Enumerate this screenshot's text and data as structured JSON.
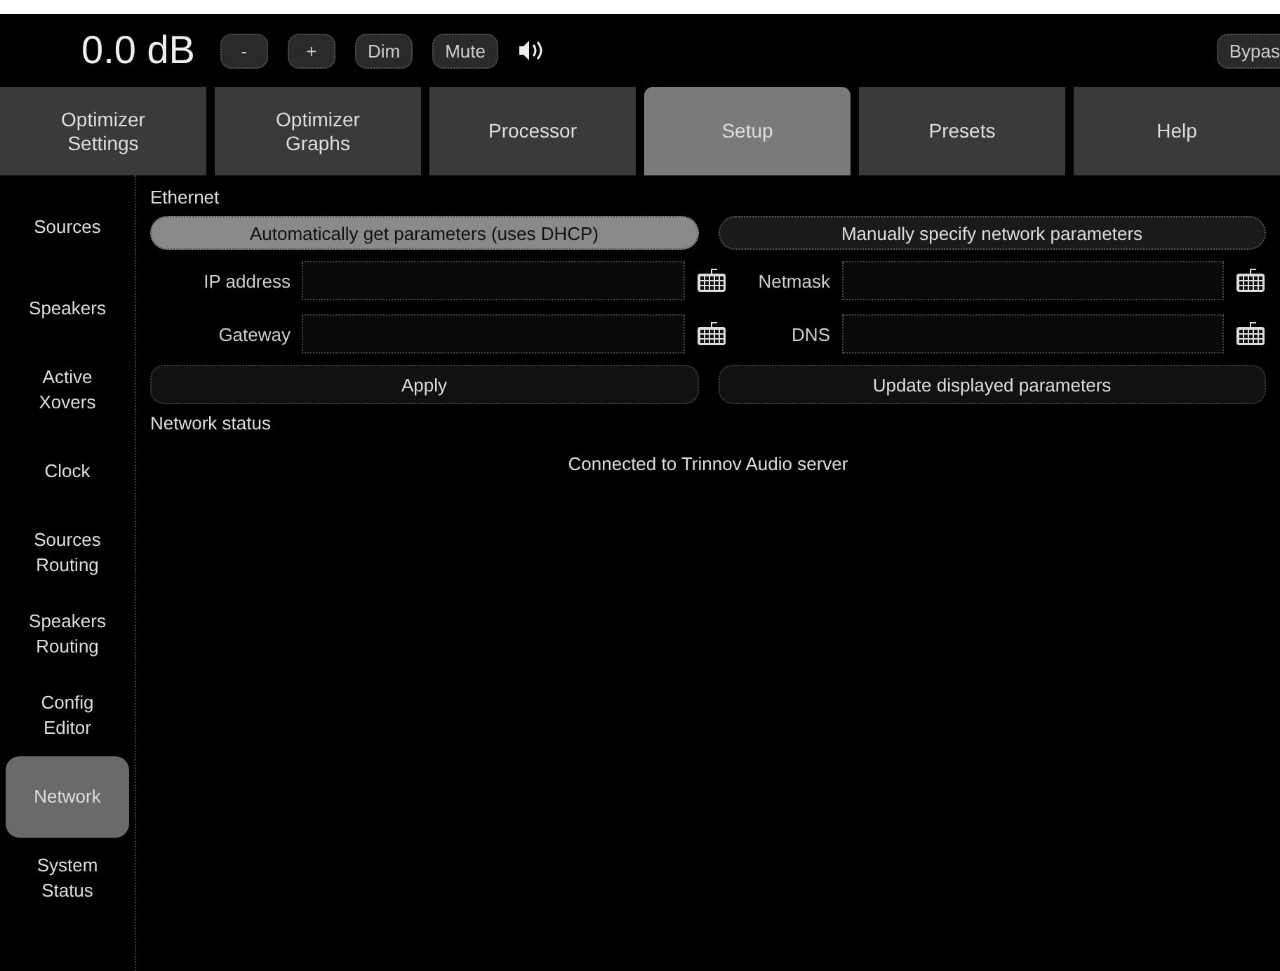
{
  "top_bar": {
    "volume": "0.0 dB",
    "buttons": [
      "-",
      "+",
      "Dim",
      "Mute"
    ],
    "bypass": "Bypas"
  },
  "tabs": [
    {
      "label": "Optimizer\nSettings",
      "selected": false
    },
    {
      "label": "Optimizer\nGraphs",
      "selected": false
    },
    {
      "label": "Processor",
      "selected": false
    },
    {
      "label": "Setup",
      "selected": true
    },
    {
      "label": "Presets",
      "selected": false
    },
    {
      "label": "Help",
      "selected": false
    }
  ],
  "sidebar": {
    "items": [
      {
        "label": "Sources",
        "selected": false
      },
      {
        "label": "Speakers",
        "selected": false
      },
      {
        "label": "Active\nXovers",
        "selected": false
      },
      {
        "label": "Clock",
        "selected": false
      },
      {
        "label": "Sources\nRouting",
        "selected": false
      },
      {
        "label": "Speakers\nRouting",
        "selected": false
      },
      {
        "label": "Config\nEditor",
        "selected": false
      },
      {
        "label": "Network",
        "selected": true
      },
      {
        "label": "System\nStatus",
        "selected": false
      }
    ]
  },
  "ethernet": {
    "title": "Ethernet",
    "modes": [
      {
        "label": "Automatically get parameters (uses DHCP)",
        "selected": true
      },
      {
        "label": "Manually specify network parameters",
        "selected": false
      }
    ],
    "fields": [
      {
        "label": "IP address"
      },
      {
        "label": "Netmask"
      },
      {
        "label": "Gateway"
      },
      {
        "label": "DNS"
      }
    ],
    "actions": [
      "Apply",
      "Update displayed parameters"
    ]
  },
  "network_status": {
    "title": "Network status",
    "message": "Connected to Trinnov Audio server"
  }
}
